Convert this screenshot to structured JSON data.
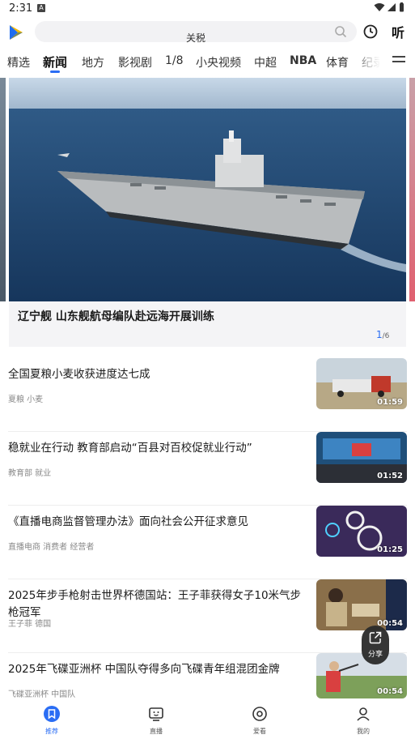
{
  "status_bar": {
    "time": "2:31",
    "notif_badge": "A"
  },
  "header": {
    "search_hint": "关税",
    "listen_label": "听"
  },
  "tabs": [
    "精选",
    "新闻",
    "地方",
    "影视剧",
    "1/8",
    "小央视频",
    "中超",
    "NBA",
    "体育",
    "纪录"
  ],
  "active_tab": "新闻",
  "hero": {
    "title": "辽宁舰 山东舰航母编队赴远海开展训练",
    "page_current": "1",
    "page_total": "/6"
  },
  "news": [
    {
      "title": "全国夏粮小麦收获进度达七成",
      "tags": "夏粮 小麦",
      "duration": "01:59"
    },
    {
      "title": "稳就业在行动 教育部启动“百县对百校促就业行动”",
      "tags": "教育部 就业",
      "duration": "01:52"
    },
    {
      "title": "《直播电商监督管理办法》面向社会公开征求意见",
      "tags": "直播电商 消费者 经营者",
      "duration": "01:25"
    },
    {
      "title": "2025年步手枪射击世界杯德国站：王子菲获得女子10米气步枪冠军",
      "tags": "王子菲 德国",
      "duration": "00:54"
    },
    {
      "title": "2025年飞碟亚洲杯 中国队夺得多向飞碟青年组混团金牌",
      "tags": "飞碟亚洲杯 中国队",
      "duration": "00:54"
    }
  ],
  "share_fab": {
    "label": "分享"
  },
  "bottom_nav": [
    {
      "label": "推荐",
      "icon": "bookmark-icon",
      "active": true
    },
    {
      "label": "直播",
      "icon": "tv-icon",
      "active": false
    },
    {
      "label": "爱看",
      "icon": "circle-play-icon",
      "active": false
    },
    {
      "label": "我的",
      "icon": "user-icon",
      "active": false
    }
  ],
  "colors": {
    "accent": "#2a6df4",
    "text": "#1a1a1a",
    "muted": "#8a8a8a"
  }
}
